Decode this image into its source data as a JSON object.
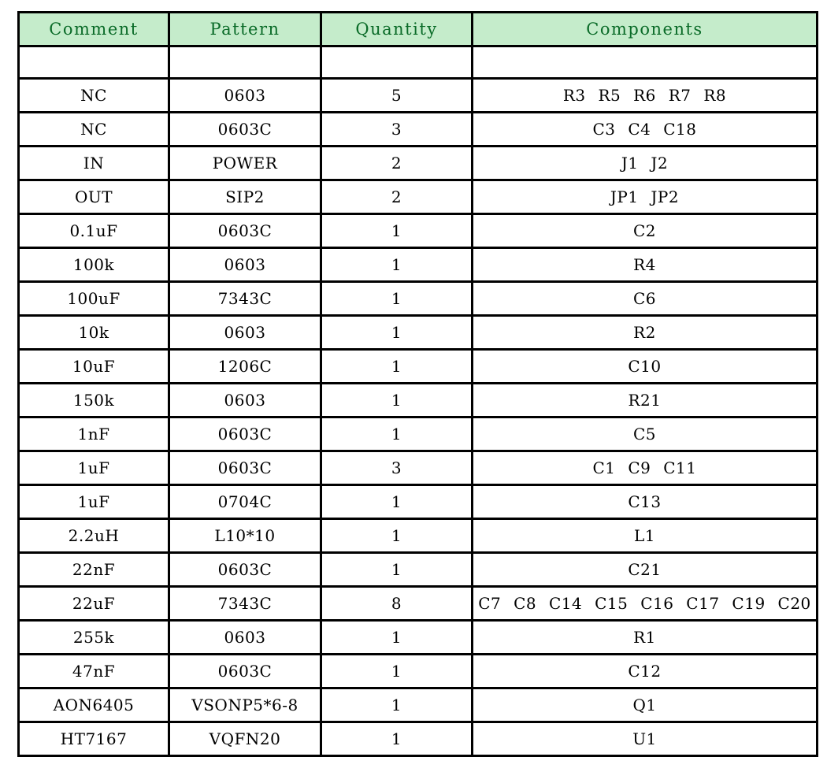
{
  "document": {
    "type": "bill-of-materials-table",
    "background_color": "#ffffff"
  },
  "colors": {
    "header_background": "#c5eccb",
    "header_text": "#0a6b28",
    "border": "#000000",
    "cell_text": "#000000",
    "cell_background": "#ffffff"
  },
  "table": {
    "columns": [
      {
        "key": "comment",
        "label": "Comment"
      },
      {
        "key": "pattern",
        "label": "Pattern"
      },
      {
        "key": "quantity",
        "label": "Quantity"
      },
      {
        "key": "components",
        "label": "Components"
      }
    ],
    "blank_row": {
      "comment": "",
      "pattern": "",
      "quantity": "",
      "components": ""
    },
    "rows": [
      {
        "comment": "NC",
        "pattern": "0603",
        "quantity": "5",
        "components": "R3 R5 R6 R7 R8"
      },
      {
        "comment": "NC",
        "pattern": "0603C",
        "quantity": "3",
        "components": "C3 C4 C18"
      },
      {
        "comment": "IN",
        "pattern": "POWER",
        "quantity": "2",
        "components": "J1 J2"
      },
      {
        "comment": "OUT",
        "pattern": "SIP2",
        "quantity": "2",
        "components": "JP1 JP2"
      },
      {
        "comment": "0.1uF",
        "pattern": "0603C",
        "quantity": "1",
        "components": "C2"
      },
      {
        "comment": "100k",
        "pattern": "0603",
        "quantity": "1",
        "components": "R4"
      },
      {
        "comment": "100uF",
        "pattern": "7343C",
        "quantity": "1",
        "components": "C6"
      },
      {
        "comment": "10k",
        "pattern": "0603",
        "quantity": "1",
        "components": "R2"
      },
      {
        "comment": "10uF",
        "pattern": "1206C",
        "quantity": "1",
        "components": "C10"
      },
      {
        "comment": "150k",
        "pattern": "0603",
        "quantity": "1",
        "components": "R21"
      },
      {
        "comment": "1nF",
        "pattern": "0603C",
        "quantity": "1",
        "components": "C5"
      },
      {
        "comment": "1uF",
        "pattern": "0603C",
        "quantity": "3",
        "components": "C1 C9 C11"
      },
      {
        "comment": "1uF",
        "pattern": "0704C",
        "quantity": "1",
        "components": "C13"
      },
      {
        "comment": "2.2uH",
        "pattern": "L10*10",
        "quantity": "1",
        "components": "L1"
      },
      {
        "comment": "22nF",
        "pattern": "0603C",
        "quantity": "1",
        "components": "C21"
      },
      {
        "comment": "22uF",
        "pattern": "7343C",
        "quantity": "8",
        "components": "C7 C8 C14 C15 C16 C17 C19 C20"
      },
      {
        "comment": "255k",
        "pattern": "0603",
        "quantity": "1",
        "components": "R1"
      },
      {
        "comment": "47nF",
        "pattern": "0603C",
        "quantity": "1",
        "components": "C12"
      },
      {
        "comment": "AON6405",
        "pattern": "VSONP5*6-8",
        "quantity": "1",
        "components": "Q1"
      },
      {
        "comment": "HT7167",
        "pattern": "VQFN20",
        "quantity": "1",
        "components": "U1"
      }
    ]
  }
}
